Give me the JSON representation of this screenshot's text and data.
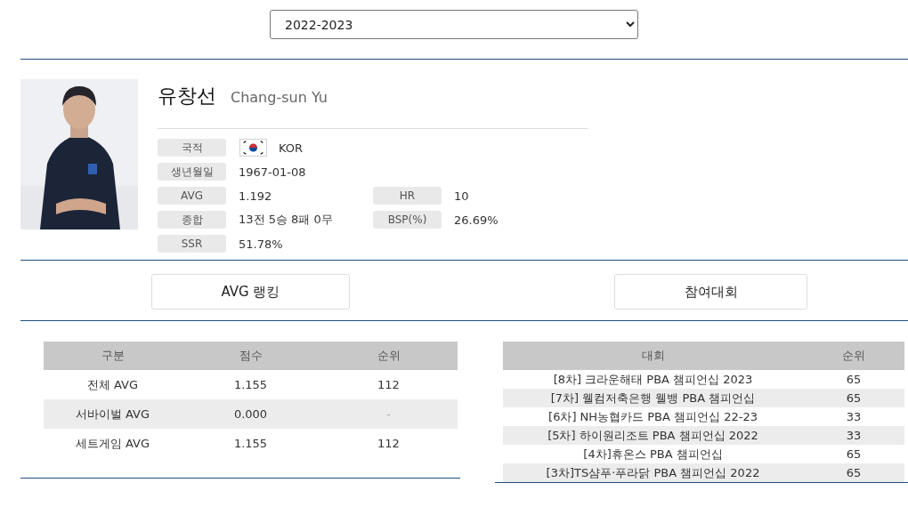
{
  "season_select": {
    "value": "2022-2023"
  },
  "player": {
    "name_ko": "유창선",
    "name_en": "Chang-sun Yu",
    "info": [
      {
        "label": "국적",
        "value": "KOR",
        "flag": true
      },
      {
        "label": "생년월일",
        "value": "1967-01-08"
      },
      {
        "label": "AVG",
        "value": "1.192",
        "side_label": "HR",
        "side_value": "10"
      },
      {
        "label": "종합",
        "value": "13전 5승 8패 0무",
        "side_label": "BSP(%)",
        "side_value": "26.69%"
      },
      {
        "label": "SSR",
        "value": "51.78%"
      }
    ]
  },
  "section_buttons": [
    "AVG 랭킹",
    "참여대회"
  ],
  "ranking_table": {
    "columns": [
      "구분",
      "점수",
      "순위"
    ],
    "rows": [
      [
        "전체 AVG",
        "1.155",
        "112"
      ],
      [
        "서바이벌 AVG",
        "0.000",
        "-"
      ],
      [
        "세트게임 AVG",
        "1.155",
        "112"
      ]
    ]
  },
  "tournament_table": {
    "columns": [
      "대회",
      "순위"
    ],
    "rows": [
      [
        "[8차] 크라운해태 PBA 챔피언십 2023",
        "65"
      ],
      [
        "[7차] 웰컴저축은행 웰뱅 PBA 챔피언십",
        "65"
      ],
      [
        "[6차] NH농협카드 PBA 챔피언십 22-23",
        "33"
      ],
      [
        "[5차] 하이원리조트 PBA 챔피언십 2022",
        "33"
      ],
      [
        "[4차]휴온스 PBA 챔피언십",
        "65"
      ],
      [
        "[3차]TS샴푸·푸라닭 PBA 챔피언십 2022",
        "65"
      ]
    ]
  }
}
